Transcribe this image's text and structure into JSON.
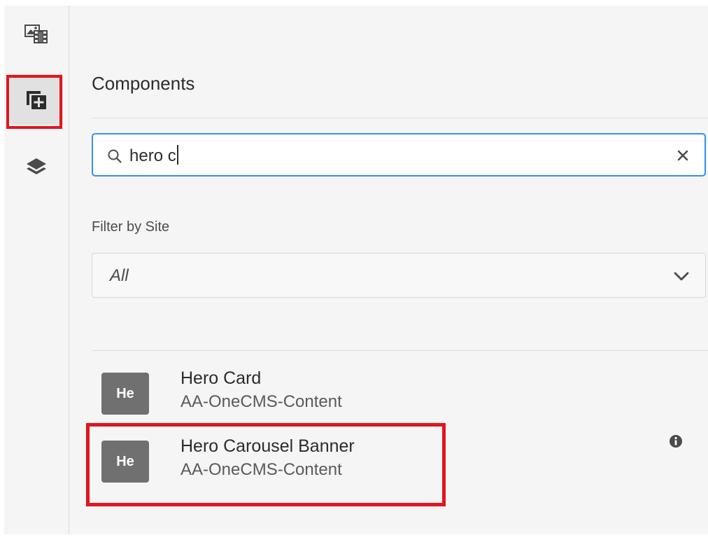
{
  "rail": {
    "items": [
      {
        "icon": "assets-icon",
        "label": ""
      },
      {
        "icon": "add-component-icon",
        "label": ""
      },
      {
        "icon": "layers-icon",
        "label": ""
      }
    ]
  },
  "panel": {
    "title": "Components",
    "search": {
      "value": "hero c",
      "placeholder": ""
    },
    "filter": {
      "label": "Filter by Site",
      "selected": "All"
    },
    "results": [
      {
        "badge": "He",
        "title": "Hero Card",
        "group": "AA-OneCMS-Content"
      },
      {
        "badge": "He",
        "title": "Hero Carousel Banner",
        "group": "AA-OneCMS-Content"
      }
    ]
  },
  "colors": {
    "highlight": "#e3141d",
    "focus": "#378ef0",
    "badge": "#707070"
  }
}
